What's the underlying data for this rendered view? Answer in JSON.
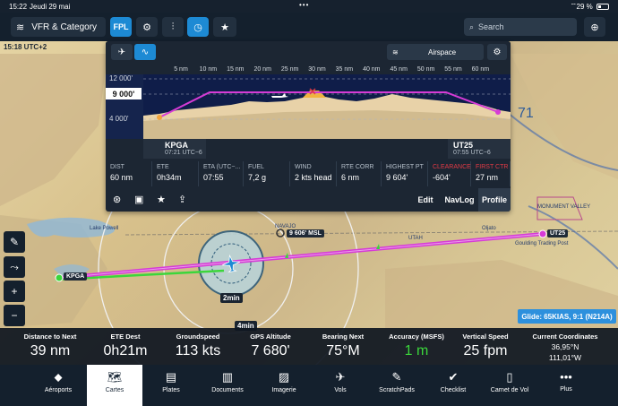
{
  "status_bar": {
    "time": "15:22",
    "date": "Jeudi 29 mai",
    "dots": "•••",
    "battery": "29 %"
  },
  "toolbar": {
    "layers_label": "VFR & Category",
    "fpl_label": "FPL",
    "search_placeholder": "Search",
    "icons": [
      "layers-icon",
      "gear-icon",
      "route-icon",
      "gauge-icon",
      "star-clock-icon",
      "search-icon",
      "locate-icon"
    ]
  },
  "map": {
    "utc_label": "15:18 UTC+2",
    "departure": "KPGA",
    "arrival": "UT25",
    "waypoint_alt": "9 606' MSL",
    "timer_2": "2min",
    "timer_4": "4min",
    "glide": "Glide: 65KIAS, 9:1 (N214A)",
    "labels": {
      "lake": "Lake Powell",
      "oljato": "Oljato",
      "utah": "UTAH",
      "goulding": "Goulding Trading Post",
      "navajo": "NAVAJO",
      "monument": "MONUMENT VALLEY",
      "num71": "71"
    }
  },
  "profile": {
    "airspace_label": "Airspace",
    "scale": [
      "5 nm",
      "10 nm",
      "15 nm",
      "20 nm",
      "25 nm",
      "30 nm",
      "35 nm",
      "40 nm",
      "45 nm",
      "50 nm",
      "55 nm",
      "60 nm"
    ],
    "alt_labels": [
      "12 000'",
      "4 000'"
    ],
    "current_alt": "9 000'",
    "departure": {
      "id": "KPGA",
      "time": "07:21 UTC−6"
    },
    "arrival": {
      "id": "UT25",
      "time": "07:55 UTC−6"
    },
    "stats": [
      {
        "key": "DIST",
        "value": "60 nm"
      },
      {
        "key": "ETE",
        "value": "0h34m"
      },
      {
        "key": "ETA (UTC−...",
        "value": "07:55"
      },
      {
        "key": "FUEL",
        "value": "7,2 g"
      },
      {
        "key": "WIND",
        "value": "2 kts head"
      },
      {
        "key": "RTE CORR",
        "value": "6 nm"
      },
      {
        "key": "HIGHEST PT",
        "value": "9 604'"
      },
      {
        "key": "CLEARANCE",
        "value": "-604'"
      },
      {
        "key": "FIRST CTR",
        "value": "27 nm"
      }
    ],
    "tabs": {
      "edit": "Edit",
      "navlog": "NavLog",
      "profile": "Profile"
    }
  },
  "instruments": [
    {
      "key": "Distance to Next",
      "value": "39 nm"
    },
    {
      "key": "ETE Dest",
      "value": "0h21m"
    },
    {
      "key": "Groundspeed",
      "value": "113 kts"
    },
    {
      "key": "GPS Altitude",
      "value": "7 680'"
    },
    {
      "key": "Bearing Next",
      "value": "75°M"
    },
    {
      "key": "Accuracy (MSFS)",
      "value": "1 m"
    },
    {
      "key": "Vertical Speed",
      "value": "25 fpm"
    },
    {
      "key": "Current Coordinates",
      "lat": "36,95°N",
      "lon": "111,01°W"
    }
  ],
  "tabbar": [
    {
      "label": "Aéroports",
      "icon": "airport-icon"
    },
    {
      "label": "Cartes",
      "icon": "map-icon",
      "active": true
    },
    {
      "label": "Plates",
      "icon": "plates-icon"
    },
    {
      "label": "Documents",
      "icon": "documents-icon"
    },
    {
      "label": "Imagerie",
      "icon": "imagery-icon"
    },
    {
      "label": "Vols",
      "icon": "flights-icon"
    },
    {
      "label": "ScratchPads",
      "icon": "scratchpad-icon"
    },
    {
      "label": "Checklist",
      "icon": "checklist-icon"
    },
    {
      "label": "Carnet de Vol",
      "icon": "logbook-icon"
    },
    {
      "label": "Plus",
      "icon": "more-icon"
    }
  ],
  "colors": {
    "accent": "#1d8ad4",
    "route": "#d63bd6",
    "green": "#3bd63b",
    "red": "#e23a45"
  }
}
